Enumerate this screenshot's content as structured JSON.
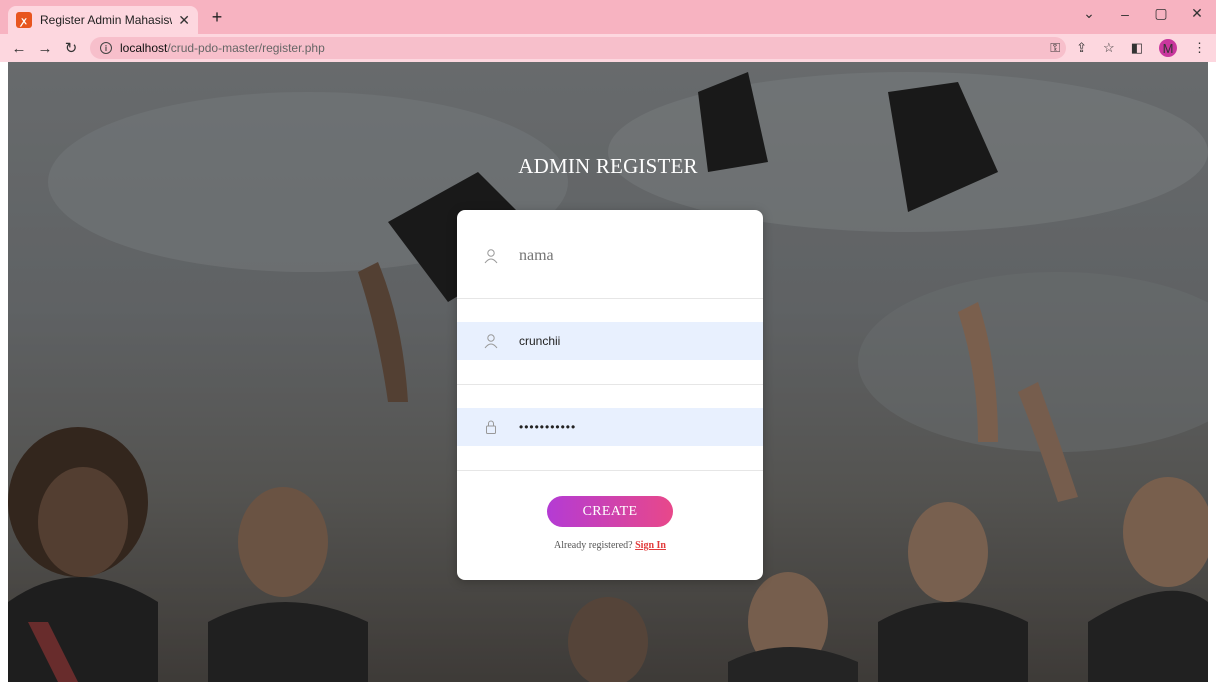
{
  "browser": {
    "tab_title": "Register Admin Mahasiswa",
    "url_host": "localhost",
    "url_path": "/crud-pdo-master/register.php",
    "profile_initial": "M"
  },
  "page": {
    "title": "ADMIN REGISTER"
  },
  "form": {
    "nama_placeholder": "nama",
    "username_value": "crunchii",
    "password_value": "•••••••••••",
    "create_label": "CREATE",
    "footer_prefix": "Already registered?",
    "signin_label": "Sign In"
  }
}
